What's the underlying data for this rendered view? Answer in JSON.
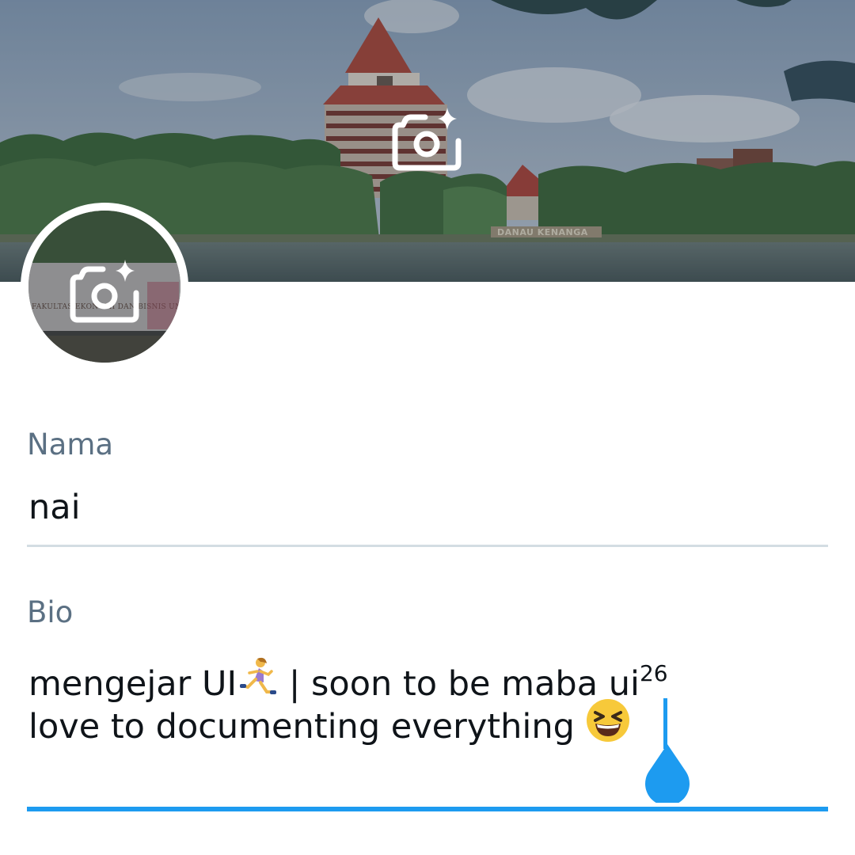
{
  "banner": {
    "image_description": "Campus tower building with red pyramid roof by a lake",
    "sign_text": "DANAU KENANGA",
    "camera_icon": "camera-sparkle-icon"
  },
  "avatar": {
    "image_description": "Faculty sign photo",
    "sign_text": "FAKULTAS EKONOMI DAN BISNIS UNIVERSITAS INDONESIA",
    "camera_icon": "camera-sparkle-icon"
  },
  "name_field": {
    "label": "Nama",
    "value": "nai"
  },
  "bio_field": {
    "label": "Bio",
    "line1_prefix": "mengejar UI",
    "line1_suffix": " | soon to be maba ui",
    "line1_sup": "26",
    "line2": "love to documenting everything "
  },
  "colors": {
    "accent": "#1d9bf0",
    "label": "#5b7083",
    "text": "#0f1419",
    "divider": "#d3dde3"
  }
}
